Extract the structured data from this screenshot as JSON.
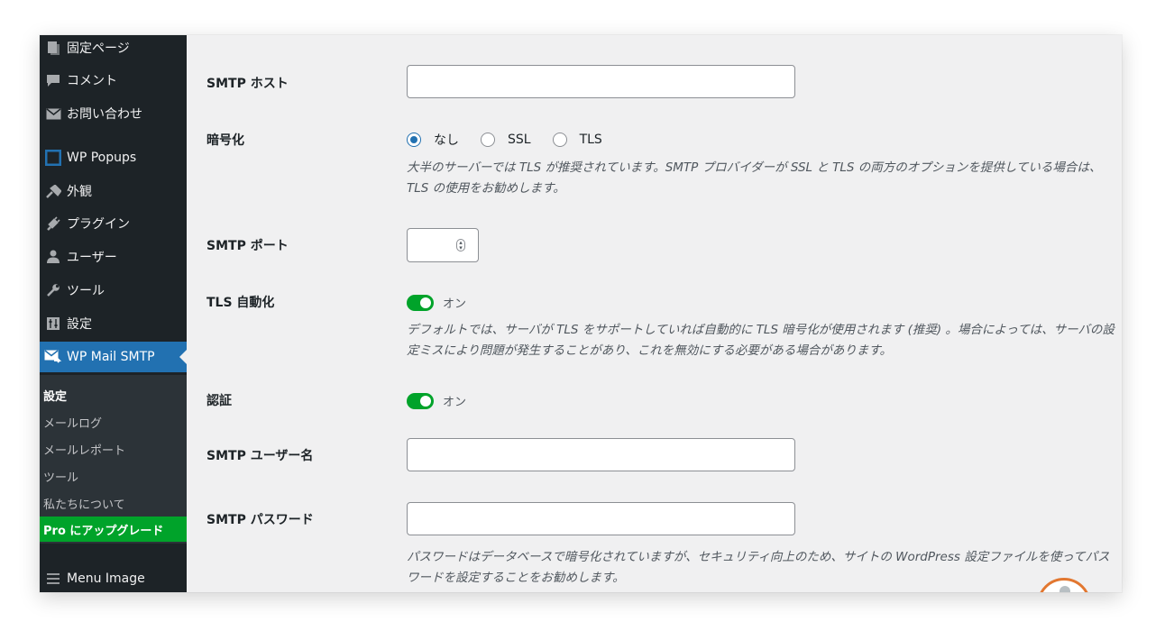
{
  "sidebar": {
    "items": [
      {
        "label": "固定ページ",
        "icon": "pages-icon"
      },
      {
        "label": "コメント",
        "icon": "comment-icon"
      },
      {
        "label": "お問い合わせ",
        "icon": "mail-icon"
      },
      {
        "label": "WP Popups",
        "icon": "popup-icon"
      },
      {
        "label": "外観",
        "icon": "appearance-icon"
      },
      {
        "label": "プラグイン",
        "icon": "plugin-icon"
      },
      {
        "label": "ユーザー",
        "icon": "user-icon"
      },
      {
        "label": "ツール",
        "icon": "wrench-icon"
      },
      {
        "label": "設定",
        "icon": "settings-icon"
      },
      {
        "label": "WP Mail SMTP",
        "icon": "mail-smtp-icon",
        "active": true
      },
      {
        "label": "Menu Image",
        "icon": "menu-icon"
      }
    ],
    "submenu": [
      {
        "label": "設定",
        "current": true
      },
      {
        "label": "メールログ"
      },
      {
        "label": "メールレポート"
      },
      {
        "label": "ツール"
      },
      {
        "label": "私たちについて"
      },
      {
        "label": "Pro にアップグレード"
      }
    ]
  },
  "form": {
    "smtp_host": {
      "label": "SMTP ホスト",
      "value": ""
    },
    "encryption": {
      "label": "暗号化",
      "options": [
        "なし",
        "SSL",
        "TLS"
      ],
      "selected": "なし",
      "description": "大半のサーバーでは TLS が推奨されています。SMTP プロバイダーが SSL と TLS の両方のオプションを提供している場合は、TLS の使用をお勧めします。"
    },
    "smtp_port": {
      "label": "SMTP ポート",
      "value": ""
    },
    "auto_tls": {
      "label": "TLS 自動化",
      "state": "オン",
      "description": "デフォルトでは、サーバが TLS をサポートしていれば自動的に TLS 暗号化が使用されます (推奨) 。場合によっては、サーバの設定ミスにより問題が発生することがあり、これを無効にする必要がある場合があります。"
    },
    "auth": {
      "label": "認証",
      "state": "オン"
    },
    "smtp_username": {
      "label": "SMTP ユーザー名",
      "value": ""
    },
    "smtp_password": {
      "label": "SMTP パスワード",
      "value": "",
      "description": "パスワードはデータベースで暗号化されていますが、セキュリティ向上のため、サイトの WordPress 設定ファイルを使ってパスワードを設定することをお勧めします。"
    }
  },
  "colors": {
    "sidebar_bg": "#1d2327",
    "active_blue": "#2271b1",
    "toggle_green": "#00a32a",
    "pro_green": "#00a32a",
    "content_bg": "#f0f0f1"
  }
}
